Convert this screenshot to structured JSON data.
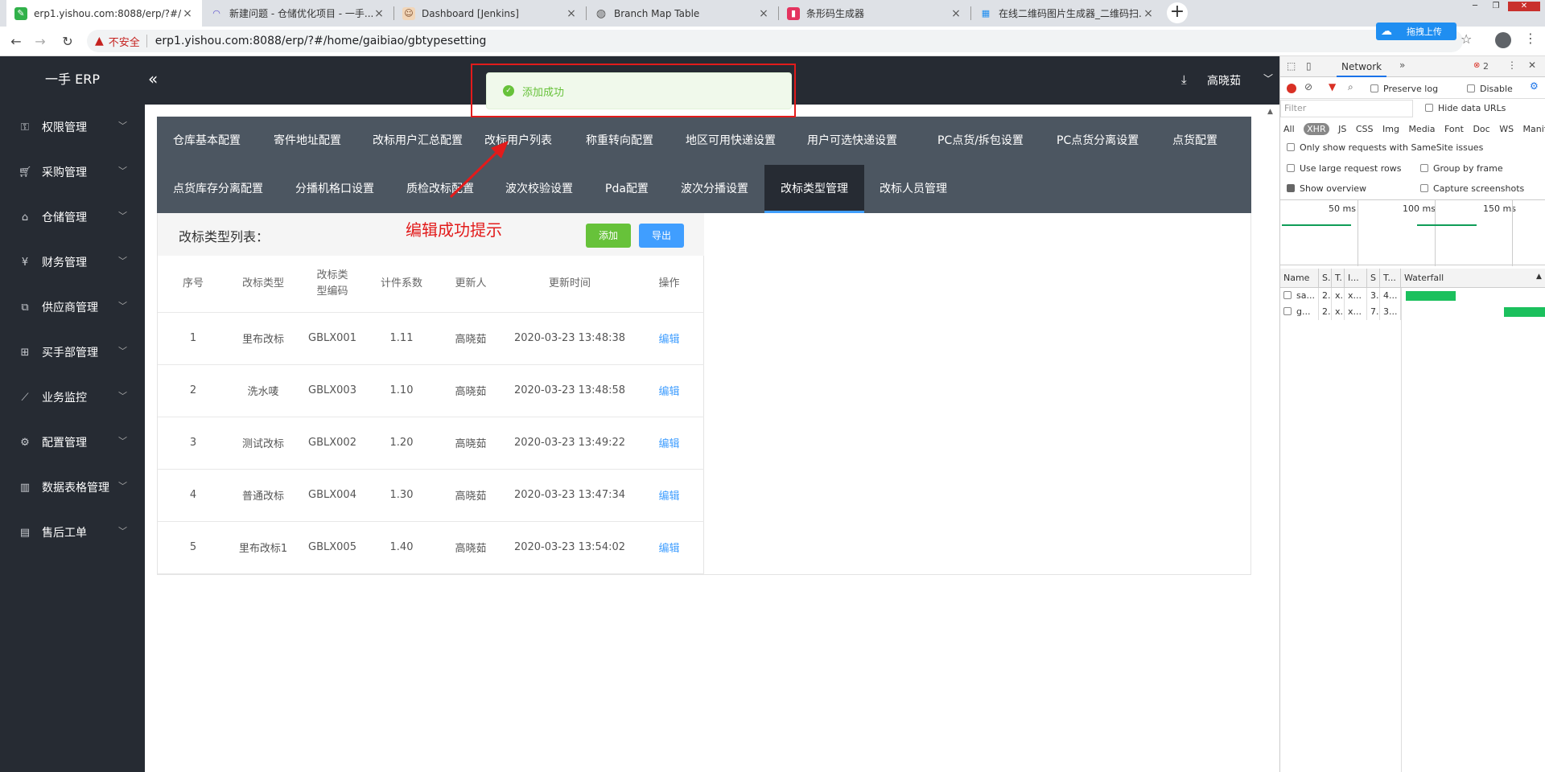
{
  "browser": {
    "tabs": [
      {
        "title": "erp1.yishou.com:8088/erp/?#/",
        "icon": "leaf-icon",
        "color": "#31b14a"
      },
      {
        "title": "新建问题 - 仓储优化项目 - 一手...",
        "icon": "arc-icon",
        "color": "#5b4fcf"
      },
      {
        "title": "Dashboard [Jenkins]",
        "icon": "jenkins-icon",
        "color": "#b07b5b"
      },
      {
        "title": "Branch Map Table",
        "icon": "globe-icon",
        "color": "#666666"
      },
      {
        "title": "条形码生成器",
        "icon": "barcode-icon",
        "color": "#e4335f"
      },
      {
        "title": "在线二维码图片生成器_二维码扫...",
        "icon": "qrcode-icon",
        "color": "#1f8ef1"
      }
    ],
    "insecure_label": "不安全",
    "url": "erp1.yishou.com:8088/erp/?#/home/gaibiao/gbtypesetting",
    "extension_label": "拖拽上传"
  },
  "app": {
    "logo": "一手 ERP",
    "user": "高晓茹",
    "sidebar": [
      {
        "label": "权限管理",
        "icon": "lock-icon"
      },
      {
        "label": "采购管理",
        "icon": "cart-icon"
      },
      {
        "label": "仓储管理",
        "icon": "home-icon"
      },
      {
        "label": "财务管理",
        "icon": "coin-icon"
      },
      {
        "label": "供应商管理",
        "icon": "supplier-icon"
      },
      {
        "label": "买手部管理",
        "icon": "buyer-icon"
      },
      {
        "label": "业务监控",
        "icon": "chart-icon"
      },
      {
        "label": "配置管理",
        "icon": "gear-icon"
      },
      {
        "label": "数据表格管理",
        "icon": "bar-icon"
      },
      {
        "label": "售后工单",
        "icon": "doc-icon"
      }
    ],
    "toast": "添加成功",
    "annotation": "编辑成功提示",
    "config_tabs_row1": [
      "仓库基本配置",
      "寄件地址配置",
      "改标用户汇总配置",
      "改标用户列表",
      "称重转向配置",
      "地区可用快递设置",
      "用户可选快递设置",
      "PC点货/拆包设置",
      "PC点货分离设置",
      "点货配置"
    ],
    "config_tabs_row2": [
      "点货库存分离配置",
      "分播机格口设置",
      "质检改标配置",
      "波次校验设置",
      "Pda配置",
      "波次分播设置",
      "改标类型管理",
      "改标人员管理"
    ],
    "list": {
      "title": "改标类型列表：",
      "add": "添加",
      "export": "导出",
      "headers": [
        "序号",
        "改标类型",
        "改标类型编码",
        "计件系数",
        "更新人",
        "更新时间",
        "操作"
      ],
      "rows": [
        [
          "1",
          "里布改标",
          "GBLX001",
          "1.11",
          "高晓茹",
          "2020-03-23 13:48:38",
          "编辑"
        ],
        [
          "2",
          "洗水唛",
          "GBLX003",
          "1.10",
          "高晓茹",
          "2020-03-23 13:48:58",
          "编辑"
        ],
        [
          "3",
          "测试改标",
          "GBLX002",
          "1.20",
          "高晓茹",
          "2020-03-23 13:49:22",
          "编辑"
        ],
        [
          "4",
          "普通改标",
          "GBLX004",
          "1.30",
          "高晓茹",
          "2020-03-23 13:47:34",
          "编辑"
        ],
        [
          "5",
          "里布改标1",
          "GBLX005",
          "1.40",
          "高晓茹",
          "2020-03-23 13:54:02",
          "编辑"
        ]
      ]
    }
  },
  "devtools": {
    "panel": "Network",
    "more": "»",
    "errors": "2",
    "preserve_log": "Preserve log",
    "disable": "Disable",
    "filter_placeholder": "Filter",
    "hide_data_urls": "Hide data URLs",
    "types": [
      "All",
      "XHR",
      "JS",
      "CSS",
      "Img",
      "Media",
      "Font",
      "Doc",
      "WS",
      "Manifest"
    ],
    "same_site": "Only show requests with SameSite issues",
    "large_rows": "Use large request rows",
    "group_frame": "Group by frame",
    "show_overview": "Show overview",
    "capture": "Capture screenshots",
    "ticks": [
      "50 ms",
      "100 ms",
      "150 ms"
    ],
    "columns": [
      "Name",
      "S.",
      "T.",
      "I...",
      "S",
      "T...",
      "Waterfall"
    ],
    "rows": [
      [
        "sa...",
        "2..",
        "x..",
        "x...",
        "3..",
        "4..."
      ],
      [
        "g...",
        "2..",
        "x..",
        "x...",
        "7..",
        "3..."
      ]
    ]
  }
}
